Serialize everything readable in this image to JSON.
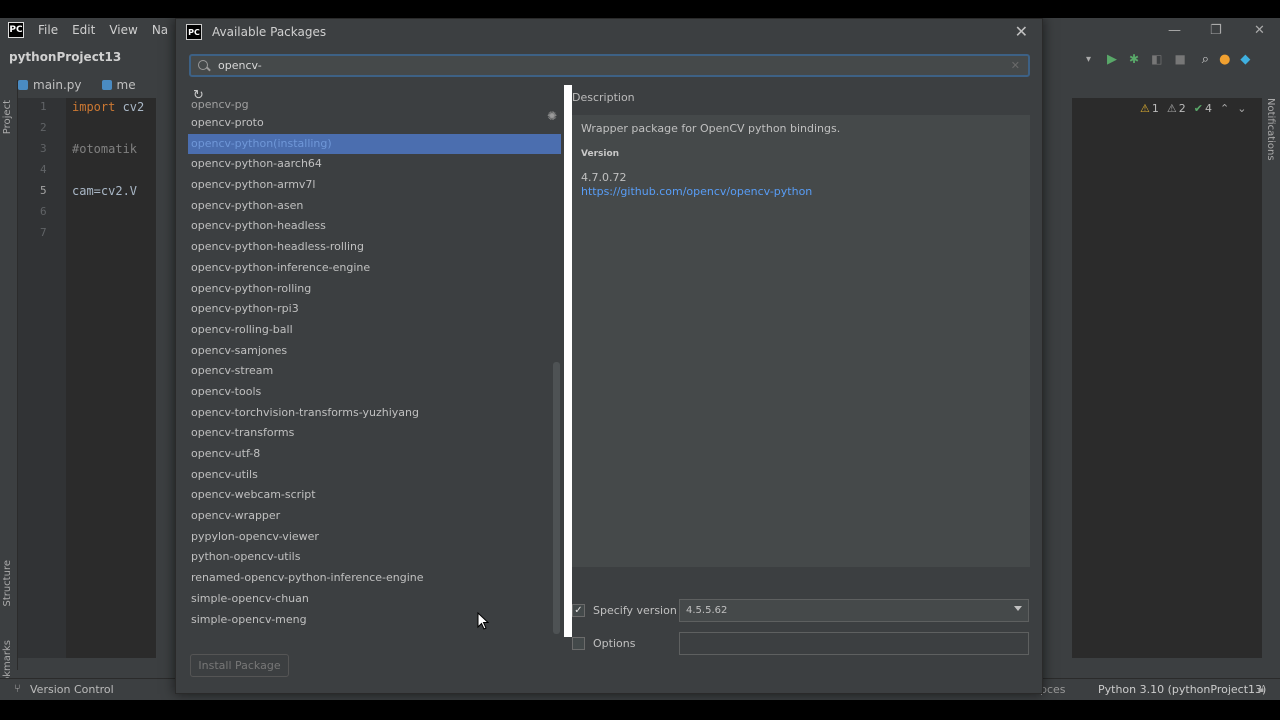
{
  "ide": {
    "menu": [
      "File",
      "Edit",
      "View",
      "Na"
    ],
    "project_name": "pythonProject13",
    "tabs": [
      "main.py",
      "me"
    ],
    "line_numbers": [
      "1",
      "2",
      "3",
      "4",
      "5",
      "6",
      "7"
    ],
    "code": {
      "line1_kw": "import",
      "line1_rest": " cv2",
      "line3": "#otomatik",
      "line5": "cam=cv2.V"
    },
    "left_strip": [
      "Project",
      "Structure",
      "Bookmarks"
    ],
    "warnings": {
      "warn": "1",
      "weak": "2",
      "ok": "4"
    },
    "notifications_label": "Notifications",
    "status": {
      "version_control": "Version Control",
      "faded": "pces",
      "interpreter": "Python 3.10 (pythonProject13)"
    }
  },
  "dialog": {
    "title": "Available Packages",
    "close_glyph": "✕",
    "search": {
      "value": "opencv-",
      "placeholder": ""
    },
    "packages": {
      "partial_top": "opencv-pg",
      "items": [
        "opencv-proto",
        "opencv-python(installing)",
        "opencv-python-aarch64",
        "opencv-python-armv7l",
        "opencv-python-asen",
        "opencv-python-headless",
        "opencv-python-headless-rolling",
        "opencv-python-inference-engine",
        "opencv-python-rolling",
        "opencv-python-rpi3",
        "opencv-rolling-ball",
        "opencv-samjones",
        "opencv-stream",
        "opencv-tools",
        "opencv-torchvision-transforms-yuzhiyang",
        "opencv-transforms",
        "opencv-utf-8",
        "opencv-utils",
        "opencv-webcam-script",
        "opencv-wrapper",
        "pypylon-opencv-viewer",
        "python-opencv-utils",
        "renamed-opencv-python-inference-engine",
        "simple-opencv-chuan",
        "simple-opencv-meng"
      ],
      "selected_index": 1
    },
    "description": {
      "label": "Description",
      "text": "Wrapper package for OpenCV python bindings.",
      "version_label": "Version",
      "version": "4.7.0.72",
      "link": "https://github.com/opencv/opencv-python"
    },
    "specify_version": {
      "label": "Specify version",
      "checked": true,
      "value": "4.5.5.62"
    },
    "options": {
      "label": "Options",
      "checked": false,
      "value": ""
    },
    "install_button": "Install Package"
  }
}
